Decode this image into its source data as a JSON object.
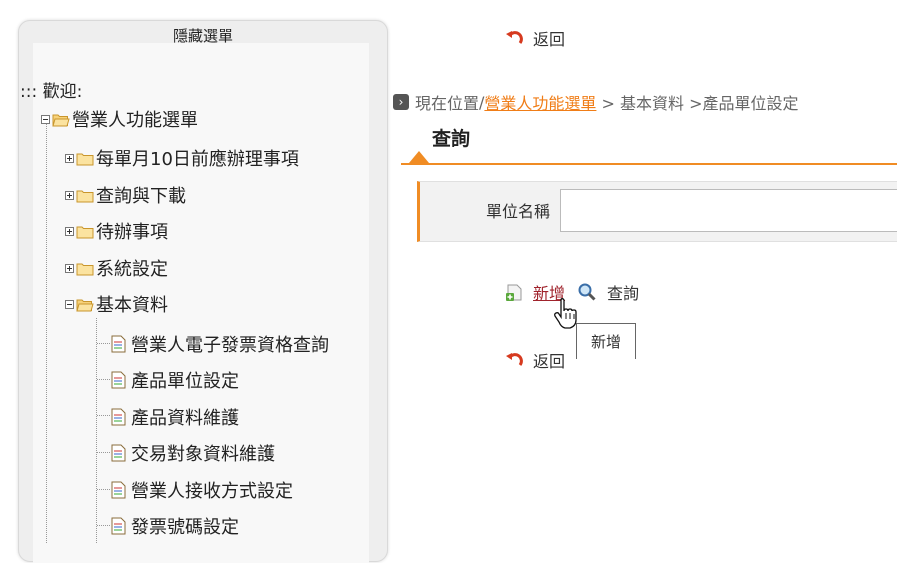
{
  "sidebar": {
    "toggle_label": "隱藏選單",
    "welcome": "::: 歡迎:",
    "root": {
      "label": "營業人功能選單"
    },
    "folders": [
      {
        "label": "每單月10日前應辦理事項"
      },
      {
        "label": "查詢與下載"
      },
      {
        "label": "待辦事項"
      },
      {
        "label": "系統設定"
      },
      {
        "label": "基本資料"
      }
    ],
    "items": [
      {
        "label": "營業人電子發票資格查詢"
      },
      {
        "label": "產品單位設定"
      },
      {
        "label": "產品資料維護"
      },
      {
        "label": "交易對象資料維護"
      },
      {
        "label": "營業人接收方式設定"
      },
      {
        "label": "發票號碼設定"
      }
    ]
  },
  "header": {
    "back_label": "返回"
  },
  "breadcrumb": {
    "arrow": "›",
    "prefix": "現在位置",
    "sep": "/",
    "link": "營業人功能選單",
    "rest": " > 基本資料 >產品單位設定"
  },
  "section_title": "查詢",
  "form": {
    "unit_name_label": "單位名稱",
    "unit_name_value": ""
  },
  "actions": {
    "add_label": "新增",
    "search_label": "查詢"
  },
  "footer": {
    "back_label": "返回"
  },
  "tooltip": "新增",
  "colors": {
    "accent": "#f08c24",
    "link": "#a0232c",
    "breadcrumb_link": "#f07d17"
  }
}
